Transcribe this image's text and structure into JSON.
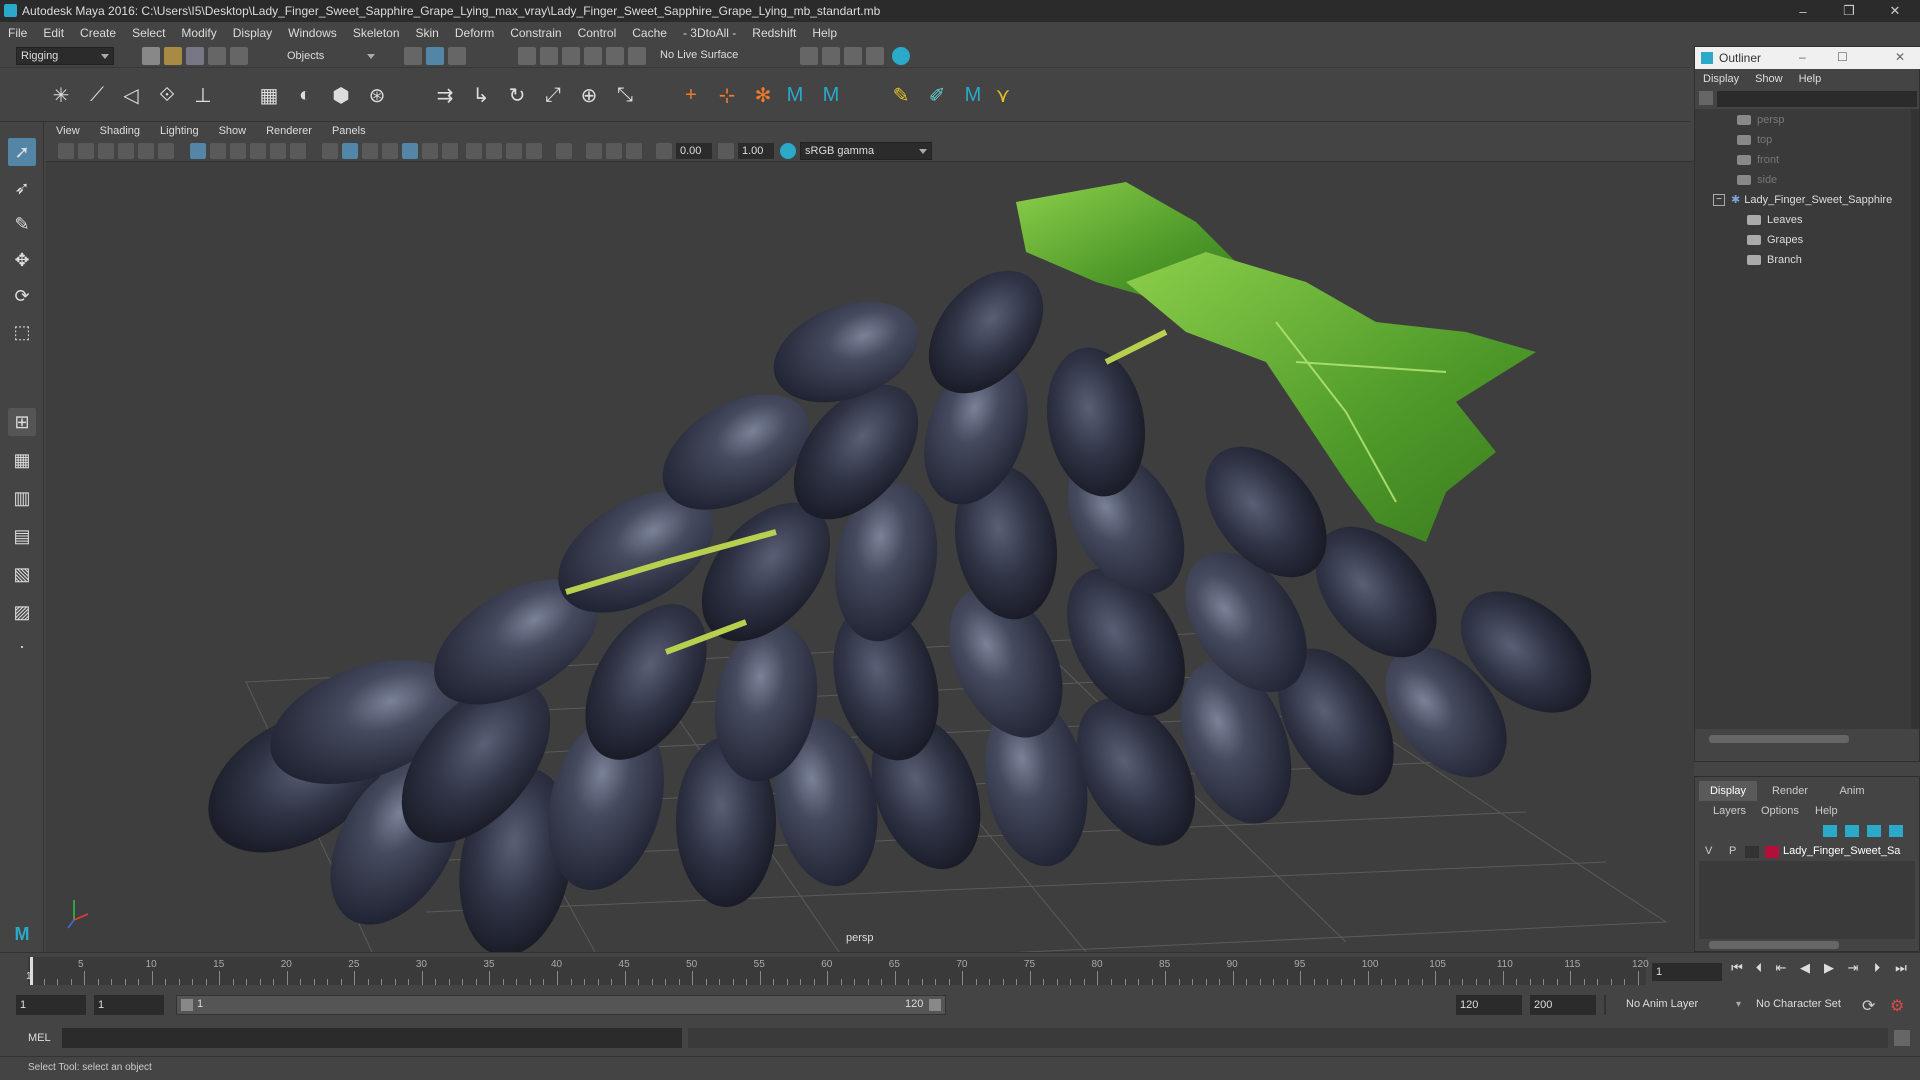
{
  "window": {
    "title": "Autodesk Maya 2016: C:\\Users\\I5\\Desktop\\Lady_Finger_Sweet_Sapphire_Grape_Lying_max_vray\\Lady_Finger_Sweet_Sapphire_Grape_Lying_mb_standart.mb",
    "minimize": "–",
    "restore": "❐",
    "close": "✕"
  },
  "menubar": [
    "File",
    "Edit",
    "Create",
    "Select",
    "Modify",
    "Display",
    "Windows",
    "Skeleton",
    "Skin",
    "Deform",
    "Constrain",
    "Control",
    "Cache",
    "- 3DtoAll -",
    "Redshift",
    "Help"
  ],
  "statusline": {
    "menuset": "Rigging",
    "select_mode": "Objects",
    "live_surface": "No Live Surface"
  },
  "viewport": {
    "menu": [
      "View",
      "Shading",
      "Lighting",
      "Show",
      "Renderer",
      "Panels"
    ],
    "exposure": "0.00",
    "gamma": "1.00",
    "colorspace": "sRGB gamma",
    "camera_label": "persp"
  },
  "outliner": {
    "title": "Outliner",
    "menu": [
      "Display",
      "Show",
      "Help"
    ],
    "items": [
      {
        "label": "persp",
        "indent": 0
      },
      {
        "label": "top",
        "indent": 0
      },
      {
        "label": "front",
        "indent": 0
      },
      {
        "label": "side",
        "indent": 0
      },
      {
        "label": "Lady_Finger_Sweet_Sapphire",
        "indent": 0
      },
      {
        "label": "Leaves",
        "indent": 1
      },
      {
        "label": "Grapes",
        "indent": 1
      },
      {
        "label": "Branch",
        "indent": 1
      }
    ],
    "expand_symbol": "−"
  },
  "layers": {
    "tabs": [
      "Display",
      "Render",
      "Anim"
    ],
    "menu": [
      "Layers",
      "Options",
      "Help"
    ],
    "row": {
      "v": "V",
      "p": "P",
      "name": "Lady_Finger_Sweet_Sa",
      "color": "#b0103a"
    }
  },
  "timeline": {
    "ticks": [
      "5",
      "10",
      "15",
      "20",
      "25",
      "30",
      "35",
      "40",
      "45",
      "50",
      "55",
      "60",
      "65",
      "70",
      "75",
      "80",
      "85",
      "90",
      "95",
      "100",
      "105",
      "110",
      "115",
      "120"
    ],
    "start_tick": "1",
    "current_frame": "1"
  },
  "range": {
    "start": "1",
    "playback_start": "1",
    "slider_start": "1",
    "slider_end": "120",
    "playback_end": "120",
    "end": "200",
    "anim_layer": "No Anim Layer",
    "character_set": "No Character Set"
  },
  "cmdline": {
    "lang": "MEL"
  },
  "helpline": {
    "text": "Select Tool: select an object"
  },
  "colors": {
    "accent": "#2aa9c9",
    "leaf": "#5fb32e",
    "grape": "#34384a",
    "selection": "#5285a6"
  }
}
